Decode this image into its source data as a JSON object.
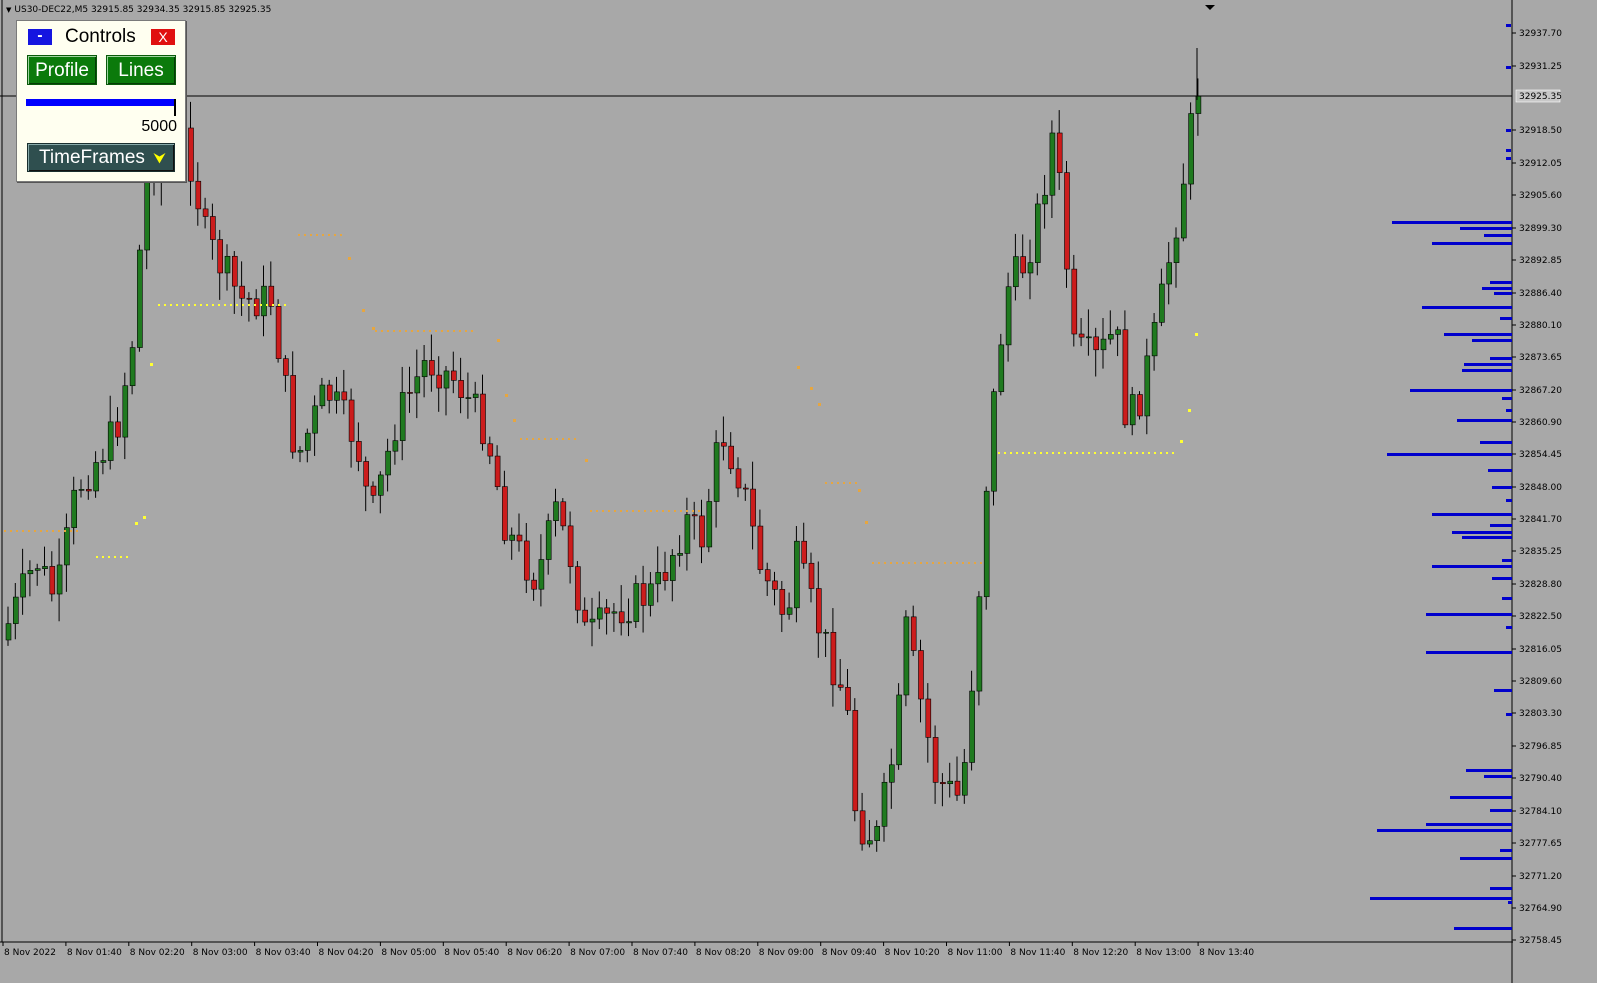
{
  "chart": {
    "symbol_header": "US30-DEC22,M5  32915.85 32934.35 32915.85 32925.35",
    "current_price_label": "32925.35",
    "colors": {
      "background": "#a8a8a8",
      "bull_candle": "#1f7a1f",
      "bear_candle": "#cc1c1c",
      "profile_bars": "#0000cc",
      "poc_dots": "#ffff33",
      "level_dots": "#e6a640"
    },
    "price_axis_labels": [
      "32937.70",
      "32931.25",
      "32918.50",
      "32912.05",
      "32905.60",
      "32899.30",
      "32892.85",
      "32886.40",
      "32880.10",
      "32873.65",
      "32867.20",
      "32860.90",
      "32854.45",
      "32848.00",
      "32841.70",
      "32835.25",
      "32828.80",
      "32822.50",
      "32816.05",
      "32809.60",
      "32803.30",
      "32796.85",
      "32790.40",
      "32784.10",
      "32777.65",
      "32771.20",
      "32764.90",
      "32758.45"
    ],
    "time_axis_labels": [
      "8 Nov 2022",
      "8 Nov 01:40",
      "8 Nov 02:20",
      "8 Nov 03:00",
      "8 Nov 03:40",
      "8 Nov 04:20",
      "8 Nov 05:00",
      "8 Nov 05:40",
      "8 Nov 06:20",
      "8 Nov 07:00",
      "8 Nov 07:40",
      "8 Nov 08:20",
      "8 Nov 09:00",
      "8 Nov 09:40",
      "8 Nov 10:20",
      "8 Nov 11:00",
      "8 Nov 11:40",
      "8 Nov 12:20",
      "8 Nov 13:00",
      "8 Nov 13:40"
    ]
  },
  "controls": {
    "title": "Controls",
    "minimize_label": "-",
    "close_label": "X",
    "profile_label": "Profile",
    "lines_label": "Lines",
    "slider_value": "5000",
    "slider_fraction": 1.0,
    "timeframes_label": "TimeFrames",
    "timeframes_icon": "chevron-double-down-icon"
  },
  "chart_data": {
    "type": "candlestick",
    "x": [
      "8 Nov 2022",
      "8 Nov 01:40",
      "8 Nov 02:20",
      "8 Nov 03:00",
      "8 Nov 03:40",
      "8 Nov 04:20",
      "8 Nov 05:00",
      "8 Nov 05:40",
      "8 Nov 06:20",
      "8 Nov 07:00",
      "8 Nov 07:40",
      "8 Nov 08:20",
      "8 Nov 09:00",
      "8 Nov 09:40",
      "8 Nov 10:20",
      "8 Nov 11:00",
      "8 Nov 11:40",
      "8 Nov 12:20",
      "8 Nov 13:00",
      "8 Nov 13:40"
    ],
    "close_approx": [
      32832,
      32852,
      32885,
      32888,
      32872,
      32863,
      32872,
      32863,
      32838,
      32822,
      32850,
      32852,
      32818,
      32782,
      32818,
      32820,
      32890,
      32870,
      32870,
      32925.35
    ],
    "ylim": [
      32755,
      32942
    ],
    "last_price": 32925.35,
    "high": 32934.35
  }
}
